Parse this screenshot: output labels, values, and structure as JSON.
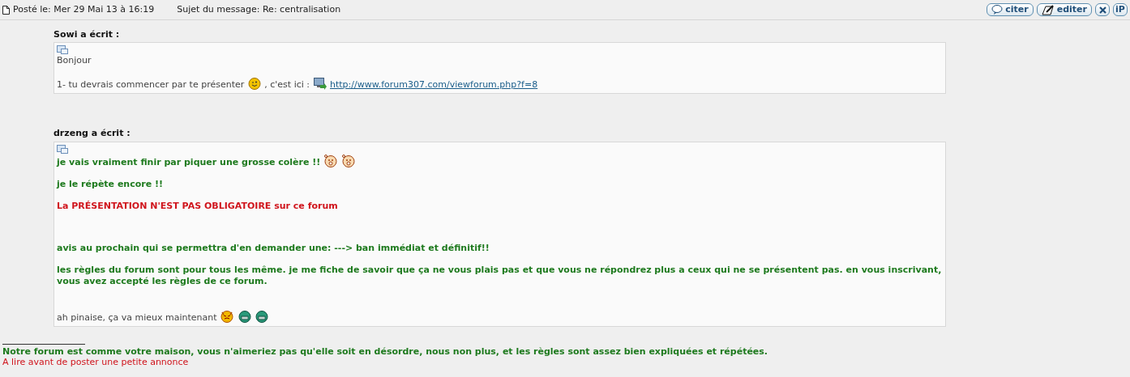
{
  "post_header": {
    "posted": "Posté le: Mer 29 Mai 13 à 16:19",
    "subject": "Sujet du message: Re: centralisation",
    "buttons": [
      {
        "kind": "quote",
        "label": "citer"
      },
      {
        "kind": "edit",
        "label": "editer"
      },
      {
        "kind": "delete"
      },
      {
        "kind": "ip",
        "label": "iP"
      }
    ]
  },
  "quotes": [
    {
      "author": "Sowi a écrit :",
      "paragraphs": [
        {
          "kind": "normal",
          "parts": [
            {
              "kind": "text",
              "text": "Bonjour"
            }
          ]
        },
        {
          "kind": "normal",
          "parts": [
            {
              "kind": "text",
              "text": "1- tu devrais commencer par te présenter"
            },
            {
              "kind": "wink"
            },
            {
              "kind": "text",
              "text": ", c'est ici :"
            },
            {
              "kind": "link",
              "text": "http://www.forum307.com/viewforum.php?f=8"
            }
          ]
        }
      ]
    },
    {
      "author": "drzeng a écrit :",
      "paragraphs": [
        {
          "kind": "green",
          "parts": [
            {
              "kind": "text",
              "text": "je vais vraiment finir par piquer une grosse colère !!"
            },
            {
              "kind": "shocked"
            },
            {
              "kind": "shocked"
            }
          ]
        },
        {
          "kind": "green",
          "parts": [
            {
              "kind": "text",
              "text": "je le répète encore !!"
            }
          ]
        },
        {
          "kind": "red",
          "parts": [
            {
              "kind": "text",
              "text": "La PRÉSENTATION N'EST PAS OBLIGATOIRE sur ce forum"
            }
          ]
        },
        {
          "kind": "green",
          "parts": [
            {
              "kind": "text",
              "text": "avis au prochain qui se permettra d'en demander une: ---> ban immédiat et définitif!!"
            }
          ]
        },
        {
          "kind": "green",
          "parts": [
            {
              "kind": "text",
              "text": "les règles du forum sont pour tous les même. je me fiche de savoir que ça ne vous plais pas et que vous ne répondrez plus a ceux qui ne se présentent pas. en vous inscrivant, vous avez accepté les règles de ce forum."
            }
          ]
        },
        {
          "kind": "normal",
          "parts": [
            {
              "kind": "text",
              "text": "ah pinaise, ça va mieux maintenant"
            },
            {
              "kind": "devil"
            },
            {
              "kind": "grin"
            },
            {
              "kind": "grin"
            }
          ]
        }
      ]
    }
  ],
  "signature": {
    "motto": "Notre forum est comme votre maison, vous n'aimeriez pas qu'elle soit en désordre, nous non plus, et les règles sont assez bien expliquées et répétées.",
    "link": "A lire avant de poster une petite annonce"
  }
}
